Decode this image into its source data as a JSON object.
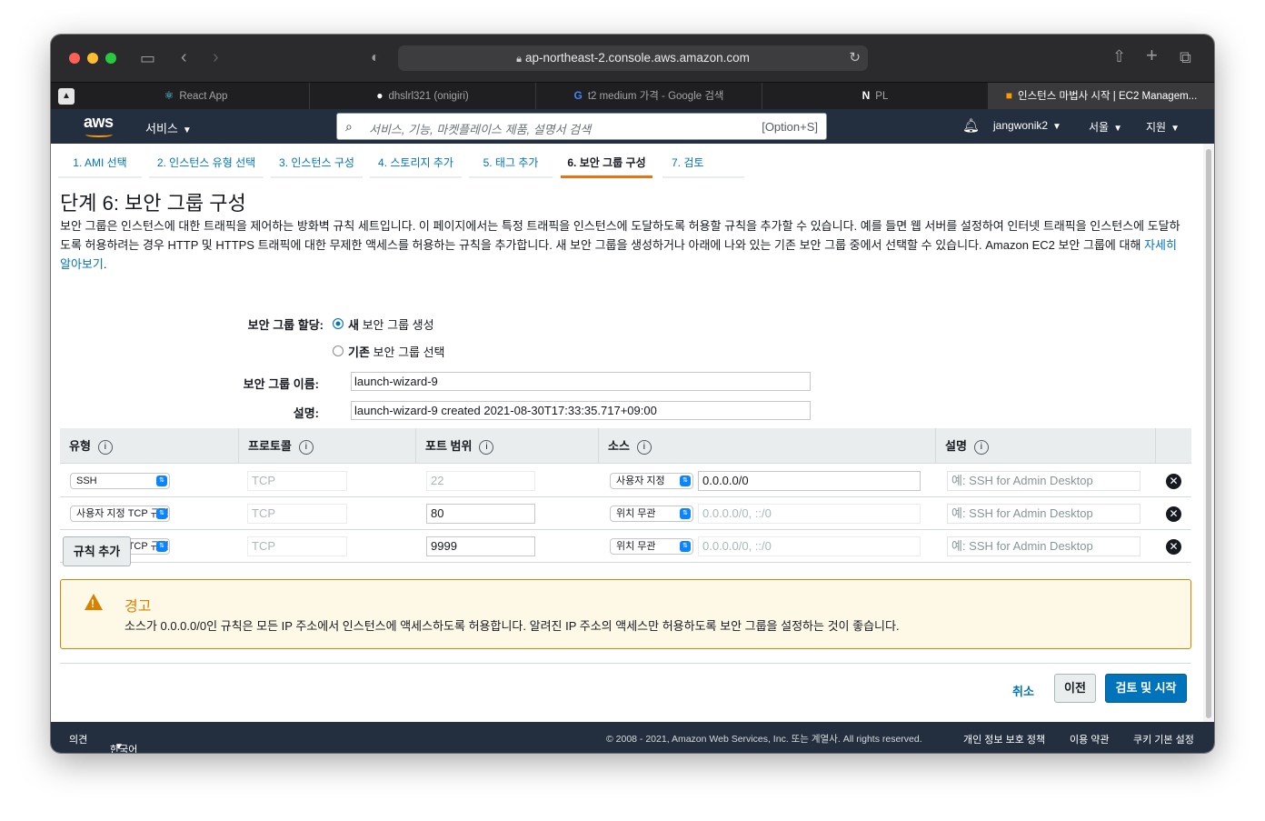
{
  "browser": {
    "url": "ap-northeast-2.console.aws.amazon.com",
    "tabs": [
      {
        "label": "React App",
        "icon": "react-icon"
      },
      {
        "label": "dhslrl321 (onigiri)",
        "icon": "github-icon"
      },
      {
        "label": "t2 medium 가격 - Google 검색",
        "icon": "google-icon"
      },
      {
        "label": "PL",
        "icon": "notion-icon"
      },
      {
        "label": "인스턴스 마법사 시작 | EC2 Managem...",
        "icon": "aws-box-icon"
      }
    ]
  },
  "awsnav": {
    "logo": "aws",
    "services": "서비스",
    "search_placeholder": "서비스, 기능, 마켓플레이스 제품, 설명서 검색",
    "search_shortcut": "[Option+S]",
    "user": "jangwonik2",
    "region": "서울",
    "support": "지원"
  },
  "steps": [
    "1. AMI 선택",
    "2. 인스턴스 유형 선택",
    "3. 인스턴스 구성",
    "4. 스토리지 추가",
    "5. 태그 추가",
    "6. 보안 그룹 구성",
    "7. 검토"
  ],
  "page": {
    "title": "단계 6: 보안 그룹 구성",
    "description": "보안 그룹은 인스턴스에 대한 트래픽을 제어하는 방화벽 규칙 세트입니다. 이 페이지에서는 특정 트래픽을 인스턴스에 도달하도록 허용할 규칙을 추가할 수 있습니다. 예를 들면 웹 서버를 설정하여 인터넷 트래픽을 인스턴스에 도달하도록 허용하려는 경우 HTTP 및 HTTPS 트래픽에 대한 무제한 액세스를 허용하는 규칙을 추가합니다. 새 보안 그룹을 생성하거나 아래에 나와 있는 기존 보안 그룹 중에서 선택할 수 있습니다. Amazon EC2 보안 그룹에 대해 ",
    "learn_more": "자세히 알아보기",
    "period": "."
  },
  "form": {
    "assign_label": "보안 그룹 할당:",
    "option_new_bold": "새",
    "option_new_rest": " 보안 그룹 생성",
    "option_existing_bold": "기존",
    "option_existing_rest": " 보안 그룹 선택",
    "name_label": "보안 그룹 이름:",
    "name_value": "launch-wizard-9",
    "desc_label": "설명:",
    "desc_value": "launch-wizard-9 created 2021-08-30T17:33:35.717+09:00"
  },
  "table": {
    "headers": [
      "유형",
      "프로토콜",
      "포트 범위",
      "소스",
      "설명"
    ],
    "info_glyph": "i",
    "rows": [
      {
        "type": "SSH",
        "protocol": "TCP",
        "port": "22",
        "source_type": "사용자 지정",
        "source": "0.0.0.0/0",
        "desc_placeholder": "예: SSH for Admin Desktop"
      },
      {
        "type": "사용자 지정 TCP 규칙",
        "protocol": "TCP",
        "port": "80",
        "source_type": "위치 무관",
        "source": "0.0.0.0/0, ::/0",
        "desc_placeholder": "예: SSH for Admin Desktop"
      },
      {
        "type": "사용자 지정 TCP 규칙",
        "protocol": "TCP",
        "port": "9999",
        "source_type": "위치 무관",
        "source": "0.0.0.0/0, ::/0",
        "desc_placeholder": "예: SSH for Admin Desktop"
      }
    ]
  },
  "add_rule": "규칙 추가",
  "warning": {
    "title": "경고",
    "text": "소스가 0.0.0.0/0인 규칙은 모든 IP 주소에서 인스턴스에 액세스하도록 허용합니다. 알려진 IP 주소의 액세스만 허용하도록 보안 그룹을 설정하는 것이 좋습니다."
  },
  "actions": {
    "cancel": "취소",
    "previous": "이전",
    "review_launch": "검토 및 시작"
  },
  "footer": {
    "feedback": "의견",
    "language": "한국어",
    "copyright": "© 2008 - 2021, Amazon Web Services, Inc. 또는 계열사. All rights reserved.",
    "privacy": "개인 정보 보호 정책",
    "terms": "이용 약관",
    "cookies": "쿠키 기본 설정"
  },
  "colors": {
    "aws_nav": "#232f3e",
    "link": "#0073bb",
    "step_active": "#ec7211",
    "warning": "#d98200",
    "primary_button": "#0073bb"
  }
}
